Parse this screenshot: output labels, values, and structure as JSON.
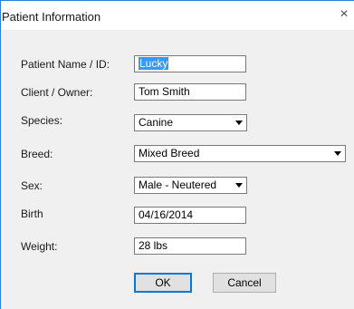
{
  "window": {
    "title": "Patient Information",
    "close_glyph": "×"
  },
  "form": {
    "patient_name_label": "Patient Name / ID:",
    "patient_name_value": "Lucky",
    "client_label": "Client / Owner:",
    "client_value": "Tom Smith",
    "species_label": "Species:",
    "species_value": "Canine",
    "breed_label": "Breed:",
    "breed_value": "Mixed Breed",
    "sex_label": "Sex:",
    "sex_value": "Male - Neutered",
    "birth_label": "Birth",
    "birth_value": "04/16/2014",
    "weight_label": "Weight:",
    "weight_value": "28 lbs"
  },
  "buttons": {
    "ok_label": "OK",
    "cancel_label": "Cancel"
  },
  "colors": {
    "accent": "#2d7fd6",
    "selection": "#3399ff"
  }
}
